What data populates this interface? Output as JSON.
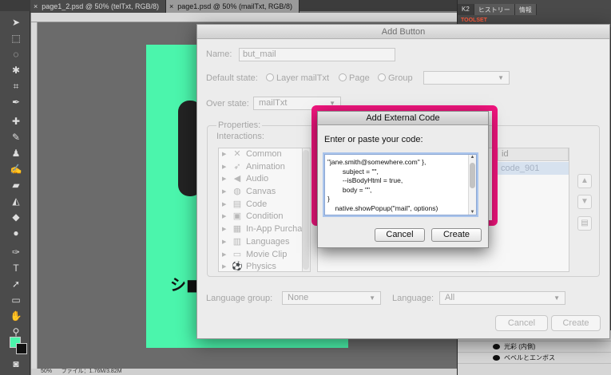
{
  "photoshop": {
    "tabs": [
      {
        "label": "page1_2.psd @ 50% (telTxt, RGB/8)"
      },
      {
        "label": "page1.psd @ 50% (mailTxt, RGB/8)"
      }
    ],
    "tab_close_glyph": "×",
    "right_tabs": [
      "K2",
      "ヒストリー",
      "情報"
    ],
    "right_label": "TOOLSET",
    "layers": [
      "効果",
      "光彩 (内側)",
      "ベベルとエンボス"
    ],
    "status_zoom": "50%",
    "status_doc": "ファイル：1.76M/3.82M",
    "doc_text": "シ■"
  },
  "add_button_dialog": {
    "title": "Add Button",
    "name_label": "Name:",
    "name_value": "but_mail",
    "default_state_label": "Default state:",
    "default_state_options": [
      "Layer mailTxt",
      "Page",
      "Group"
    ],
    "over_state_label": "Over state:",
    "over_state_value": "mailTxt",
    "properties_label": "Properties:",
    "interactions_label": "Interactions:",
    "interactions": [
      {
        "label": "Common",
        "icon": "cross-icon"
      },
      {
        "label": "Animation",
        "icon": "animation-icon"
      },
      {
        "label": "Audio",
        "icon": "speaker-icon"
      },
      {
        "label": "Canvas",
        "icon": "canvas-icon"
      },
      {
        "label": "Code",
        "icon": "code-icon"
      },
      {
        "label": "Condition",
        "icon": "condition-icon"
      },
      {
        "label": "In-App Purcha",
        "icon": "cart-icon"
      },
      {
        "label": "Languages",
        "icon": "languages-icon"
      },
      {
        "label": "Movie Clip",
        "icon": "movie-icon"
      },
      {
        "label": "Physics",
        "icon": "physics-icon"
      }
    ],
    "table_header_id": "id",
    "table_cell_id": "code_901",
    "language_group_label": "Language group:",
    "language_group_value": "None",
    "language_label": "Language:",
    "language_value": "All",
    "cancel_label": "Cancel",
    "create_label": "Create"
  },
  "external_code_dialog": {
    "title": "Add External Code",
    "prompt": "Enter or paste your code:",
    "code_lines": [
      "\"jane.smith@somewhere.com\" },",
      "        subject = \"\",",
      "        --isBodyHtml = true,",
      "        body = \"\",",
      "}",
      "    native.showPopup(\"mail\", options)"
    ],
    "cancel_label": "Cancel",
    "create_label": "Create"
  },
  "colors": {
    "highlight": "#f0157d",
    "doc_background": "#4bf5ac",
    "foreground_swatch": "#4bf5ac",
    "background_swatch": "#111111"
  }
}
